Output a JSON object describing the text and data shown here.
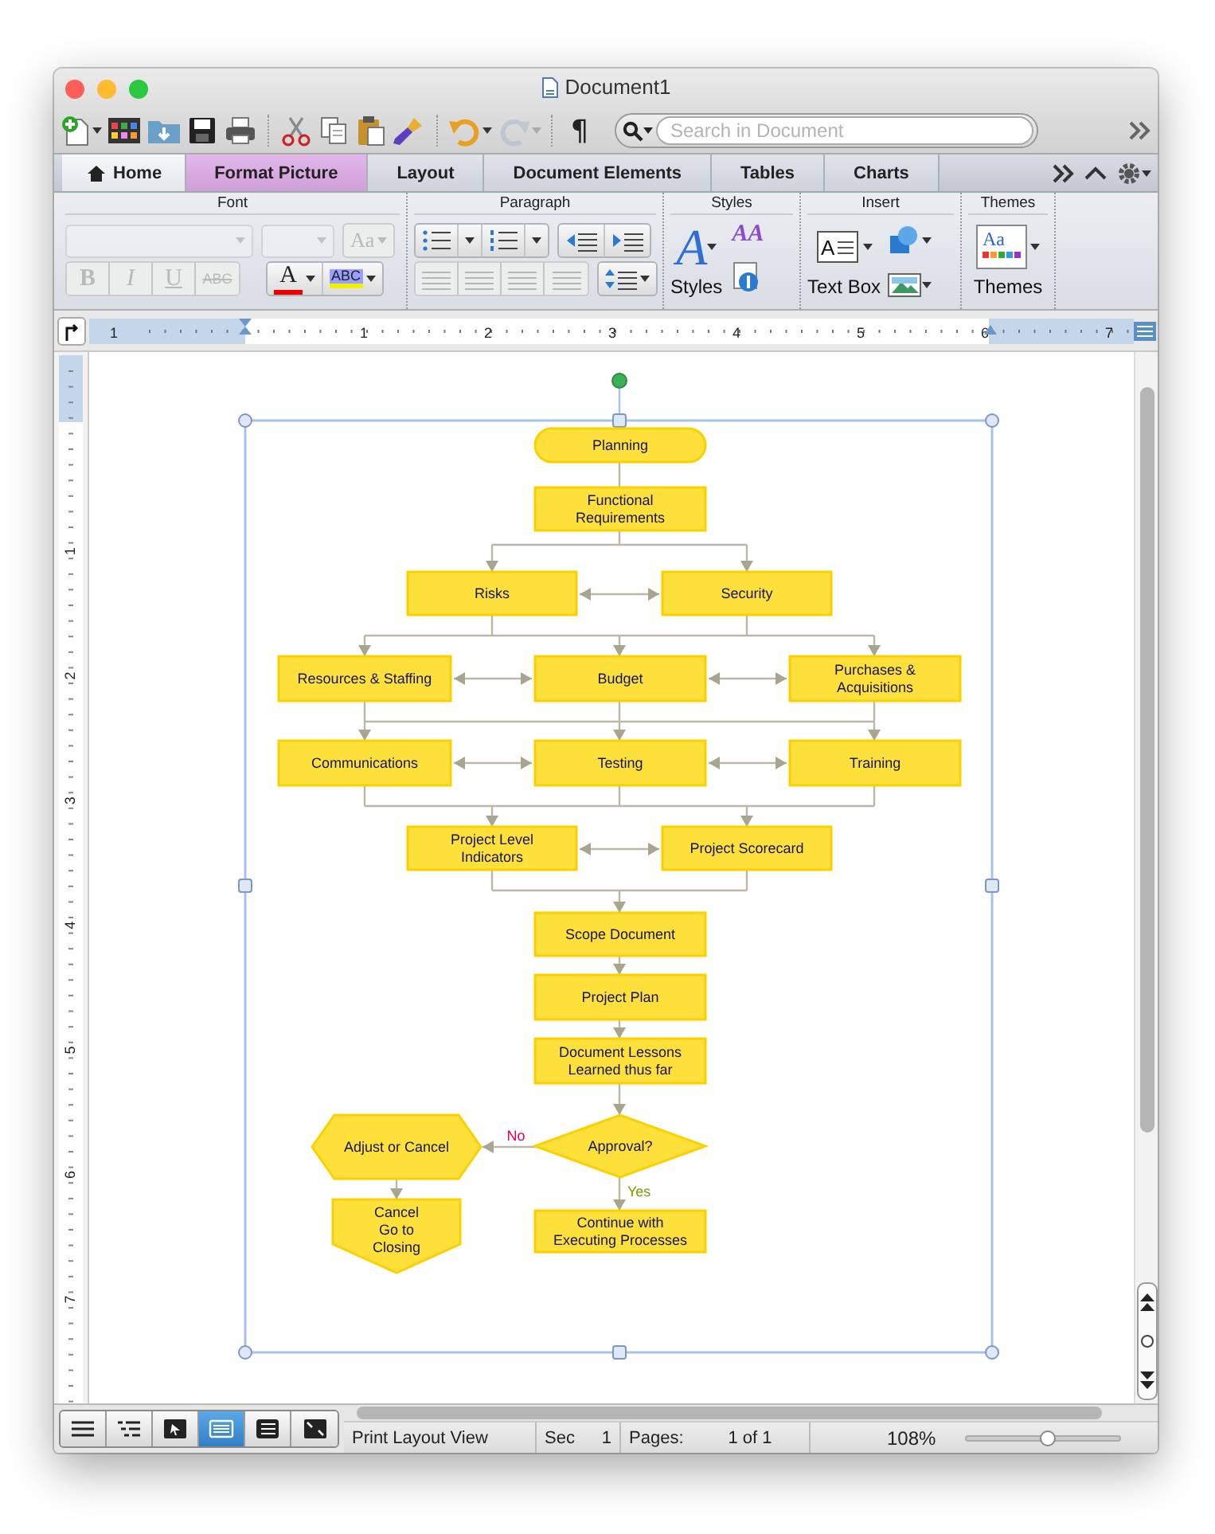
{
  "window": {
    "title": "Document1"
  },
  "toolbar": {
    "paragraph_mark": "¶",
    "redo_disabled": true,
    "search": {
      "placeholder": "Search in Document"
    }
  },
  "tabs": [
    {
      "label": "Home",
      "selected": true,
      "kind": "home"
    },
    {
      "label": "Format Picture",
      "selected": false,
      "kind": "contextual"
    },
    {
      "label": "Layout",
      "selected": false,
      "kind": "plain"
    },
    {
      "label": "Document Elements",
      "selected": false,
      "kind": "plain"
    },
    {
      "label": "Tables",
      "selected": false,
      "kind": "plain"
    },
    {
      "label": "Charts",
      "selected": false,
      "kind": "plain"
    }
  ],
  "ribbon": {
    "font": {
      "title": "Font",
      "disabled": true,
      "change_case": "Aa",
      "style_buttons": [
        {
          "label": "B",
          "kind": "bold"
        },
        {
          "label": "I",
          "kind": "italic"
        },
        {
          "label": "U",
          "kind": "underline"
        },
        {
          "label": "ABC",
          "kind": "strike"
        }
      ],
      "font_color": "A",
      "highlight": "ABC"
    },
    "paragraph": {
      "title": "Paragraph",
      "alignment_disabled": true
    },
    "styles": {
      "title": "Styles",
      "glyph": "A",
      "quick_glyph": "AA",
      "label": "Styles"
    },
    "insert": {
      "title": "Insert",
      "glyph": "A",
      "label": "Text Box"
    },
    "themes": {
      "title": "Themes",
      "glyph": "Aa",
      "label": "Themes"
    }
  },
  "rulers": {
    "horizontal": [
      "1",
      "1",
      "2",
      "3",
      "4",
      "5",
      "6",
      "7"
    ],
    "vertical": [
      "1",
      "2",
      "3",
      "4",
      "5",
      "6",
      "7"
    ]
  },
  "flowchart": {
    "nodes": [
      {
        "kind": "terminal",
        "lines": [
          "Planning"
        ]
      },
      {
        "kind": "process",
        "lines": [
          "Functional",
          "Requirements"
        ]
      },
      {
        "kind": "process",
        "lines": [
          "Risks"
        ]
      },
      {
        "kind": "process",
        "lines": [
          "Security"
        ]
      },
      {
        "kind": "process",
        "lines": [
          "Resources & Staffing"
        ]
      },
      {
        "kind": "process",
        "lines": [
          "Budget"
        ]
      },
      {
        "kind": "process",
        "lines": [
          "Purchases &",
          "Acquisitions"
        ]
      },
      {
        "kind": "process",
        "lines": [
          "Communications"
        ]
      },
      {
        "kind": "process",
        "lines": [
          "Testing"
        ]
      },
      {
        "kind": "process",
        "lines": [
          "Training"
        ]
      },
      {
        "kind": "process",
        "lines": [
          "Project Level",
          "Indicators"
        ]
      },
      {
        "kind": "process",
        "lines": [
          "Project Scorecard"
        ]
      },
      {
        "kind": "process",
        "lines": [
          "Scope Document"
        ]
      },
      {
        "kind": "process",
        "lines": [
          "Project Plan"
        ]
      },
      {
        "kind": "process",
        "lines": [
          "Document Lessons",
          "Learned thus far"
        ]
      },
      {
        "kind": "preparation",
        "lines": [
          "Adjust or Cancel"
        ]
      },
      {
        "kind": "decision",
        "lines": [
          "Approval?"
        ]
      },
      {
        "kind": "offpage",
        "lines": [
          "Cancel",
          "Go to",
          "Closing"
        ]
      },
      {
        "kind": "process",
        "lines": [
          "Continue with",
          "Executing Processes"
        ]
      }
    ],
    "edge_labels": [
      {
        "text": "No",
        "color": "#e8005a"
      },
      {
        "text": "Yes",
        "color": "#7a9c00"
      }
    ]
  },
  "view_buttons": [
    {
      "kind": "draft",
      "selected": false
    },
    {
      "kind": "outline",
      "selected": false
    },
    {
      "kind": "publishing",
      "selected": false
    },
    {
      "kind": "print",
      "selected": true
    },
    {
      "kind": "notebook",
      "selected": false
    },
    {
      "kind": "fullscreen",
      "selected": false
    }
  ],
  "status_bar": {
    "view": "Print Layout View",
    "section_label": "Sec",
    "section": "1",
    "pages_label": "Pages:",
    "pages": "1 of 1",
    "zoom": "108%",
    "zoom_slider": {
      "level": 0.53
    }
  }
}
